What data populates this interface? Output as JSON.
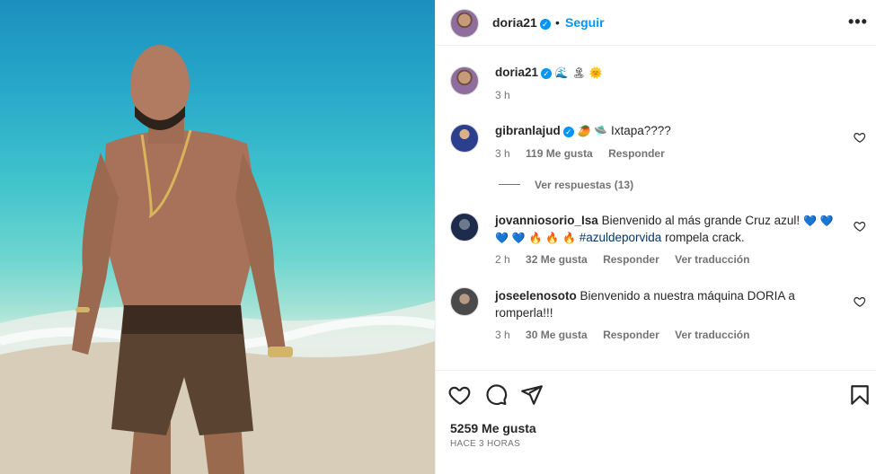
{
  "post": {
    "author": "doria21",
    "follow_label": "Seguir",
    "separator": "•",
    "caption_emojis": "🌊 🏝 🌞",
    "caption_time": "3 h"
  },
  "comments": [
    {
      "username": "gibranlajud",
      "text": "Ixtapa????",
      "emoji": "🥭 🛸",
      "time": "3 h",
      "likes": "119 Me gusta",
      "reply_label": "Responder",
      "view_replies": "Ver respuestas (13)"
    },
    {
      "username": "jovanniosorio_Isa",
      "text_1": "Bienvenido al más grande Cruz azul!",
      "emoji_1": "💙 💙",
      "emoji_2": "💙 💙 🔥 🔥 🔥",
      "hashtag": "#azuldeporvida",
      "text_2": "rompela crack.",
      "time": "2 h",
      "likes": "32 Me gusta",
      "reply_label": "Responder",
      "translate_label": "Ver traducción"
    },
    {
      "username": "joseelenosoto",
      "text_1": "Bienvenido a nuestra máquina DORIA a",
      "text_2": "romperla!!!",
      "time": "3 h",
      "likes": "30 Me gusta",
      "reply_label": "Responder",
      "translate_label": "Ver traducción"
    }
  ],
  "footer": {
    "likes": "5259 Me gusta",
    "time": "HACE 3 HORAS"
  },
  "icons": {
    "like": "heart-icon",
    "comment": "comment-icon",
    "share": "share-icon",
    "save": "bookmark-icon",
    "more": "more-options-icon",
    "verified": "verified-badge-icon"
  },
  "colors": {
    "link": "#0095f6",
    "muted": "#737373",
    "text": "#262626",
    "hashtag": "#00376b"
  }
}
